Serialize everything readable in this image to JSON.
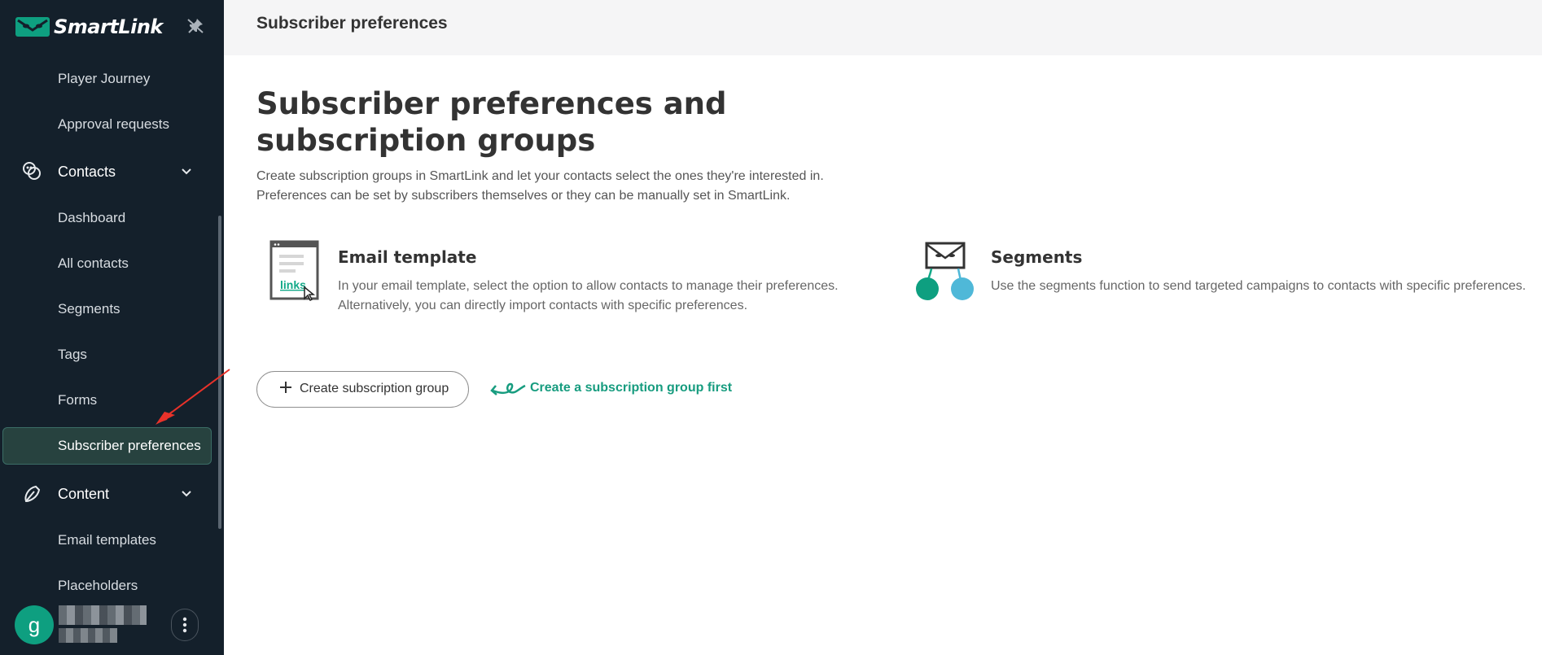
{
  "app": {
    "name": "SmartLink"
  },
  "sidebar": {
    "items": [
      {
        "label": "Player Journey",
        "type": "sub"
      },
      {
        "label": "Approval requests",
        "type": "sub"
      },
      {
        "label": "Contacts",
        "type": "section",
        "icon": "contacts-icon"
      },
      {
        "label": "Dashboard",
        "type": "sub"
      },
      {
        "label": "All contacts",
        "type": "sub"
      },
      {
        "label": "Segments",
        "type": "sub"
      },
      {
        "label": "Tags",
        "type": "sub"
      },
      {
        "label": "Forms",
        "type": "sub"
      },
      {
        "label": "Subscriber preferences",
        "type": "sub",
        "active": true
      },
      {
        "label": "Content",
        "type": "section",
        "icon": "content-icon"
      },
      {
        "label": "Email templates",
        "type": "sub"
      },
      {
        "label": "Placeholders",
        "type": "sub"
      }
    ],
    "user": {
      "initial": "g"
    }
  },
  "topbar": {
    "title": "Subscriber preferences"
  },
  "main": {
    "heading": "Subscriber preferences and subscription groups",
    "description": [
      "Create subscription groups in SmartLink and let your contacts select the ones they're interested in.",
      "Preferences can be set by subscribers themselves or they can be manually set in SmartLink."
    ],
    "cards": [
      {
        "title": "Email template",
        "icon": "email-template-icon",
        "icon_text": "links",
        "text": [
          "In your email template, select the option to allow contacts to manage their preferences.",
          "Alternatively, you can directly import contacts with specific preferences."
        ]
      },
      {
        "title": "Segments",
        "icon": "segments-icon",
        "text": [
          "Use the segments function to send targeted campaigns to contacts with specific preferences."
        ]
      }
    ],
    "create_button": "Create subscription group",
    "hint": "Create a subscription group first"
  },
  "colors": {
    "sidebar_bg": "#14202b",
    "accent_green": "#0e9f80",
    "hint_green": "#179c7f",
    "active_item_bg": "#27423f",
    "annotation_red": "#e8322a"
  }
}
